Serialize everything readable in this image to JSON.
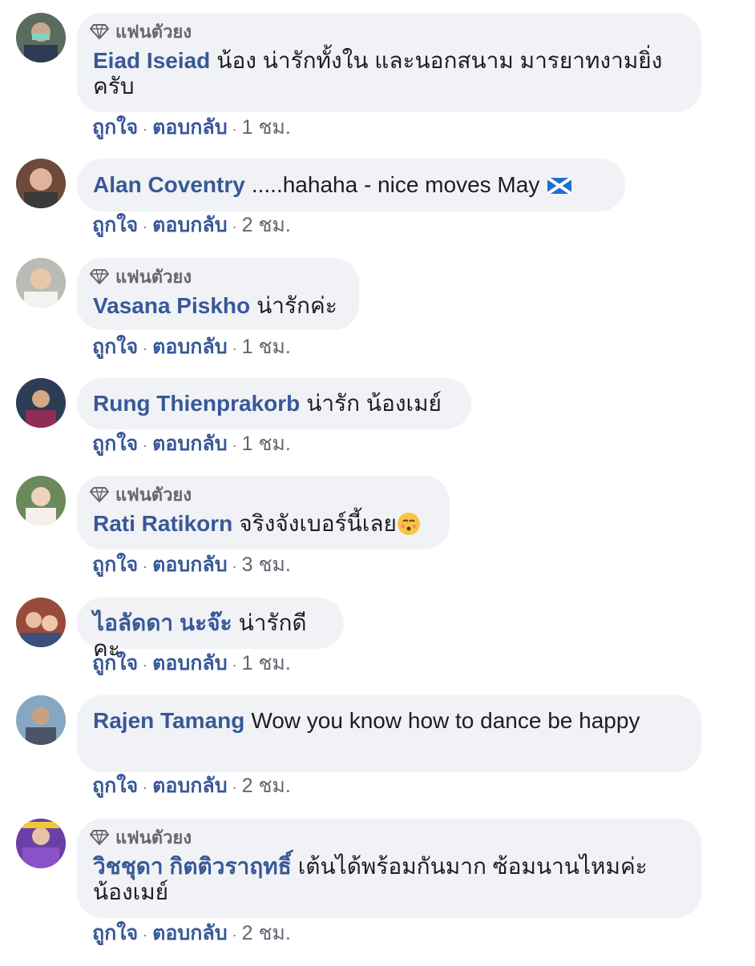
{
  "labels": {
    "fan_badge": "แฟนตัวยง",
    "like": "ถูกใจ",
    "reply": "ตอบกลับ",
    "separator": "·"
  },
  "colors": {
    "author": "#385898",
    "bubble_bg": "#f0f2f5",
    "meta": "#65676b"
  },
  "comments": [
    {
      "author": "Eiad Iseiad",
      "text": "น้อง น่ารักทั้งใน และนอกสนาม มารยาทงามยิ่งครับ",
      "time": "1 ชม.",
      "fan_badge": true,
      "avatar_icon": "avatar-photo"
    },
    {
      "author": "Alan Coventry",
      "text": ".....hahaha - nice moves May",
      "time": "2 ชม.",
      "fan_badge": false,
      "avatar_icon": "avatar-photo",
      "trailing_icon": "scotland-flag-icon"
    },
    {
      "author": "Vasana Piskho",
      "text": "น่ารักค่ะ",
      "time": "1 ชม.",
      "fan_badge": true,
      "avatar_icon": "avatar-photo"
    },
    {
      "author": "Rung Thienprakorb",
      "text": "น่ารัก น้องเมย์",
      "time": "1 ชม.",
      "fan_badge": false,
      "avatar_icon": "avatar-photo"
    },
    {
      "author": "Rati Ratikorn",
      "text": "จริงจังเบอร์นี้เลย",
      "time": "3 ชม.",
      "fan_badge": true,
      "avatar_icon": "avatar-photo",
      "trailing_icon": "kissing-face-emoji"
    },
    {
      "author": "ไอลัดดา นะจ๊ะ",
      "text": "น่ารักดีคะ",
      "time": "1 ชม.",
      "fan_badge": false,
      "avatar_icon": "avatar-photo"
    },
    {
      "author": "Rajen Tamang",
      "text": "Wow you know how to dance be happy",
      "time": "2 ชม.",
      "fan_badge": false,
      "avatar_icon": "avatar-photo"
    },
    {
      "author": "วิชชุดา กิตติวราฤทธิ์",
      "text": "เต้นได้พร้อมกันมาก ซ้อมนานไหมค่ะ น้องเมย์",
      "time": "2 ชม.",
      "fan_badge": true,
      "avatar_icon": "avatar-photo"
    }
  ]
}
